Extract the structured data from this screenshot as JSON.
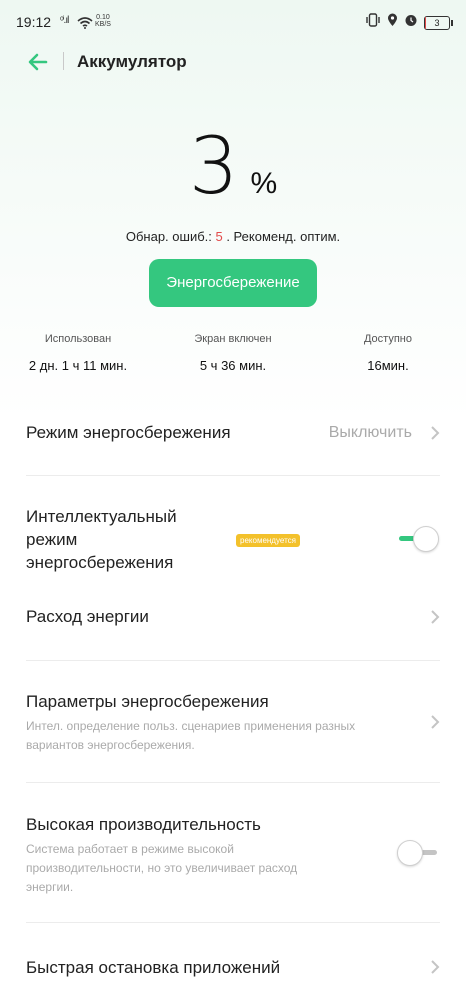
{
  "status_bar": {
    "time": "19:12",
    "signal": "ᵒⁱ.ıl",
    "net_speed_value": "0.10",
    "net_speed_unit": "KB/S",
    "battery_level": "3",
    "battery_fraction": 0.03,
    "icons": [
      "vibrate-icon",
      "location-icon",
      "alarm-icon",
      "battery-icon"
    ]
  },
  "header": {
    "title": "Аккумулятор",
    "back_icon": "arrow-left-icon"
  },
  "battery": {
    "percent": "3",
    "percent_sign": "%",
    "info_prefix": "Обнар. ошиб.: ",
    "error_count": "5",
    "info_suffix": " . Рекоменд. оптим.",
    "saver_button": "Энергосбережение"
  },
  "stats": {
    "used_label": "Использован",
    "used_value": "2 дн. 1 ч 11 мин.",
    "screen_label": "Экран включен",
    "screen_value": "5 ч 36 мин.",
    "available_label": "Доступно",
    "available_value": "16мин."
  },
  "settings": {
    "power_mode": {
      "title": "Режим энергосбережения",
      "value": "Выключить"
    },
    "smart_mode": {
      "title_line1": "Интеллектуальный",
      "title_line2": "режим",
      "title_line3": "энергосбережения",
      "badge": "рекомендуется",
      "enabled": true
    },
    "power_usage": {
      "title": "Расход энергии"
    },
    "saver_params": {
      "title": "Параметры энергосбережения",
      "desc_line1": "Интел. определение польз. сценариев применения разных",
      "desc_line2": "вариантов энергосбережения."
    },
    "high_performance": {
      "title": "Высокая производительность",
      "desc_line1": "Система работает в режиме высокой",
      "desc_line2": "производительности, но это увеличивает расход",
      "desc_line3": "энергии.",
      "enabled": false
    },
    "quick_stop": {
      "title": "Быстрая остановка приложений"
    }
  },
  "colors": {
    "accent": "#34c77f",
    "error": "#e24a4a",
    "badge": "#f3c12b",
    "page_tint": "#eef8f2"
  }
}
